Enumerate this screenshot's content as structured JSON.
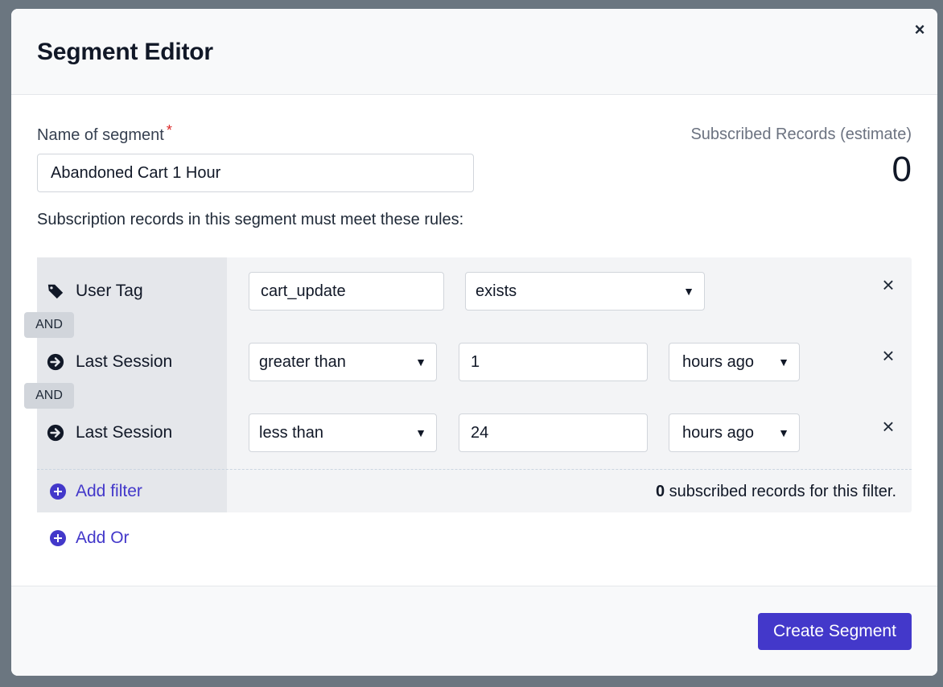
{
  "modal": {
    "title": "Segment Editor",
    "close_label": "×"
  },
  "segment": {
    "name_label": "Name of segment",
    "required_mark": "*",
    "name_value": "Abandoned Cart 1 Hour",
    "estimate_label": "Subscribed Records (estimate)",
    "estimate_value": "0",
    "rules_description": "Subscription records in this segment must meet these rules:"
  },
  "filters": [
    {
      "label": "User Tag",
      "icon": "tag-icon",
      "field1": "cart_update",
      "field2": "exists"
    },
    {
      "label": "Last Session",
      "icon": "arrow-circle-right-icon",
      "operator": "greater than",
      "value": "1",
      "unit": "hours ago"
    },
    {
      "label": "Last Session",
      "icon": "arrow-circle-right-icon",
      "operator": "less than",
      "value": "24",
      "unit": "hours ago"
    }
  ],
  "connector": "AND",
  "remove_label": "×",
  "add_filter_label": "Add filter",
  "add_or_label": "Add Or",
  "filter_count": {
    "count": "0",
    "text": " subscribed records for this filter."
  },
  "footer": {
    "create_label": "Create Segment"
  },
  "colors": {
    "accent": "#4338ca",
    "required": "#dc2626"
  }
}
